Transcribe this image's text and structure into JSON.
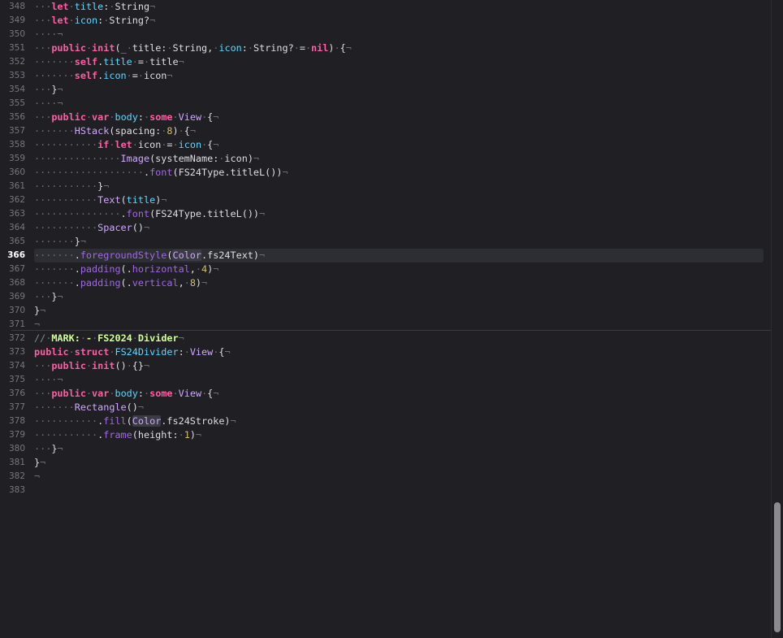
{
  "editor": {
    "current_line": 366,
    "lines": [
      {
        "n": "348",
        "t": [
          [
            "ws",
            "···"
          ],
          [
            "keyword",
            "let"
          ],
          [
            "ws",
            "·"
          ],
          [
            "decl",
            "title"
          ],
          [
            "plain",
            ":"
          ],
          [
            "ws",
            "·"
          ],
          [
            "plain",
            "String"
          ],
          [
            "eol",
            "¬"
          ]
        ]
      },
      {
        "n": "349",
        "t": [
          [
            "ws",
            "···"
          ],
          [
            "keyword",
            "let"
          ],
          [
            "ws",
            "·"
          ],
          [
            "decl",
            "icon"
          ],
          [
            "plain",
            ":"
          ],
          [
            "ws",
            "·"
          ],
          [
            "plain",
            "String?"
          ],
          [
            "eol",
            "¬"
          ]
        ]
      },
      {
        "n": "350",
        "t": [
          [
            "ws",
            "····"
          ],
          [
            "eol",
            "¬"
          ]
        ]
      },
      {
        "n": "351",
        "t": [
          [
            "ws",
            "···"
          ],
          [
            "keyword",
            "public"
          ],
          [
            "ws",
            "·"
          ],
          [
            "keyword",
            "init"
          ],
          [
            "plain",
            "("
          ],
          [
            "decl",
            "_"
          ],
          [
            "ws",
            "·"
          ],
          [
            "plain",
            "title:"
          ],
          [
            "ws",
            "·"
          ],
          [
            "plain",
            "String,"
          ],
          [
            "ws",
            "·"
          ],
          [
            "decl",
            "icon"
          ],
          [
            "plain",
            ":"
          ],
          [
            "ws",
            "·"
          ],
          [
            "plain",
            "String?"
          ],
          [
            "ws",
            "·"
          ],
          [
            "plain",
            "="
          ],
          [
            "ws",
            "·"
          ],
          [
            "keyword",
            "nil"
          ],
          [
            "plain",
            ")"
          ],
          [
            "ws",
            "·"
          ],
          [
            "plain",
            "{"
          ],
          [
            "eol",
            "¬"
          ]
        ]
      },
      {
        "n": "352",
        "t": [
          [
            "ws",
            "·······"
          ],
          [
            "keyword",
            "self"
          ],
          [
            "plain",
            "."
          ],
          [
            "decl",
            "title"
          ],
          [
            "ws",
            "·"
          ],
          [
            "plain",
            "="
          ],
          [
            "ws",
            "·"
          ],
          [
            "plain",
            "title"
          ],
          [
            "eol",
            "¬"
          ]
        ]
      },
      {
        "n": "353",
        "t": [
          [
            "ws",
            "·······"
          ],
          [
            "keyword",
            "self"
          ],
          [
            "plain",
            "."
          ],
          [
            "decl",
            "icon"
          ],
          [
            "ws",
            "·"
          ],
          [
            "plain",
            "="
          ],
          [
            "ws",
            "·"
          ],
          [
            "plain",
            "icon"
          ],
          [
            "eol",
            "¬"
          ]
        ]
      },
      {
        "n": "354",
        "t": [
          [
            "ws",
            "···"
          ],
          [
            "plain",
            "}"
          ],
          [
            "eol",
            "¬"
          ]
        ]
      },
      {
        "n": "355",
        "t": [
          [
            "ws",
            "····"
          ],
          [
            "eol",
            "¬"
          ]
        ]
      },
      {
        "n": "356",
        "t": [
          [
            "ws",
            "···"
          ],
          [
            "keyword",
            "public"
          ],
          [
            "ws",
            "·"
          ],
          [
            "keyword",
            "var"
          ],
          [
            "ws",
            "·"
          ],
          [
            "decl",
            "body"
          ],
          [
            "plain",
            ":"
          ],
          [
            "ws",
            "·"
          ],
          [
            "keyword",
            "some"
          ],
          [
            "ws",
            "·"
          ],
          [
            "type",
            "View"
          ],
          [
            "ws",
            "·"
          ],
          [
            "plain",
            "{"
          ],
          [
            "eol",
            "¬"
          ]
        ]
      },
      {
        "n": "357",
        "t": [
          [
            "ws",
            "·······"
          ],
          [
            "type",
            "HStack"
          ],
          [
            "plain",
            "(spacing:"
          ],
          [
            "ws",
            "·"
          ],
          [
            "number",
            "8"
          ],
          [
            "plain",
            ")"
          ],
          [
            "ws",
            "·"
          ],
          [
            "plain",
            "{"
          ],
          [
            "eol",
            "¬"
          ]
        ]
      },
      {
        "n": "358",
        "t": [
          [
            "ws",
            "···········"
          ],
          [
            "keyword",
            "if"
          ],
          [
            "ws",
            "·"
          ],
          [
            "keyword",
            "let"
          ],
          [
            "ws",
            "·"
          ],
          [
            "plain",
            "icon"
          ],
          [
            "ws",
            "·"
          ],
          [
            "plain",
            "="
          ],
          [
            "ws",
            "·"
          ],
          [
            "decl",
            "icon"
          ],
          [
            "ws",
            "·"
          ],
          [
            "plain",
            "{"
          ],
          [
            "eol",
            "¬"
          ]
        ]
      },
      {
        "n": "359",
        "t": [
          [
            "ws",
            "···············"
          ],
          [
            "type",
            "Image"
          ],
          [
            "plain",
            "(systemName:"
          ],
          [
            "ws",
            "·"
          ],
          [
            "plain",
            "icon)"
          ],
          [
            "eol",
            "¬"
          ]
        ]
      },
      {
        "n": "360",
        "t": [
          [
            "ws",
            "···················"
          ],
          [
            "plain",
            "."
          ],
          [
            "func",
            "font"
          ],
          [
            "plain",
            "(FS24Type.titleL())"
          ],
          [
            "eol",
            "¬"
          ]
        ]
      },
      {
        "n": "361",
        "t": [
          [
            "ws",
            "···········"
          ],
          [
            "plain",
            "}"
          ],
          [
            "eol",
            "¬"
          ]
        ]
      },
      {
        "n": "362",
        "t": [
          [
            "ws",
            "···········"
          ],
          [
            "type",
            "Text"
          ],
          [
            "plain",
            "("
          ],
          [
            "decl",
            "title"
          ],
          [
            "plain",
            ")"
          ],
          [
            "eol",
            "¬"
          ]
        ]
      },
      {
        "n": "363",
        "t": [
          [
            "ws",
            "···············"
          ],
          [
            "plain",
            "."
          ],
          [
            "func",
            "font"
          ],
          [
            "plain",
            "(FS24Type.titleL())"
          ],
          [
            "eol",
            "¬"
          ]
        ]
      },
      {
        "n": "364",
        "t": [
          [
            "ws",
            "···········"
          ],
          [
            "type",
            "Spacer"
          ],
          [
            "plain",
            "()"
          ],
          [
            "eol",
            "¬"
          ]
        ]
      },
      {
        "n": "365",
        "t": [
          [
            "ws",
            "·······"
          ],
          [
            "plain",
            "}"
          ],
          [
            "eol",
            "¬"
          ]
        ]
      },
      {
        "n": "366",
        "t": [
          [
            "ws",
            "·······"
          ],
          [
            "plain",
            "."
          ],
          [
            "func",
            "foregroundStyle"
          ],
          [
            "plain",
            "("
          ],
          [
            "typebg",
            "Color"
          ],
          [
            "plain",
            ".fs24Text)"
          ],
          [
            "eol",
            "¬"
          ]
        ]
      },
      {
        "n": "367",
        "t": [
          [
            "ws",
            "·······"
          ],
          [
            "plain",
            "."
          ],
          [
            "func",
            "padding"
          ],
          [
            "plain",
            "(."
          ],
          [
            "func",
            "horizontal"
          ],
          [
            "plain",
            ","
          ],
          [
            "ws",
            "·"
          ],
          [
            "number",
            "4"
          ],
          [
            "plain",
            ")"
          ],
          [
            "eol",
            "¬"
          ]
        ]
      },
      {
        "n": "368",
        "t": [
          [
            "ws",
            "·······"
          ],
          [
            "plain",
            "."
          ],
          [
            "func",
            "padding"
          ],
          [
            "plain",
            "(."
          ],
          [
            "func",
            "vertical"
          ],
          [
            "plain",
            ","
          ],
          [
            "ws",
            "·"
          ],
          [
            "number",
            "8"
          ],
          [
            "plain",
            ")"
          ],
          [
            "eol",
            "¬"
          ]
        ]
      },
      {
        "n": "369",
        "t": [
          [
            "ws",
            "···"
          ],
          [
            "plain",
            "}"
          ],
          [
            "eol",
            "¬"
          ]
        ]
      },
      {
        "n": "370",
        "t": [
          [
            "plain",
            "}"
          ],
          [
            "eol",
            "¬"
          ]
        ]
      },
      {
        "n": "371",
        "t": [
          [
            "eol",
            "¬"
          ]
        ]
      },
      {
        "n": "372",
        "t": [
          [
            "comment",
            "//"
          ],
          [
            "ws",
            "·"
          ],
          [
            "mark",
            "MARK:"
          ],
          [
            "ws",
            "·"
          ],
          [
            "mark",
            "-"
          ],
          [
            "ws",
            "·"
          ],
          [
            "mark",
            "FS2024"
          ],
          [
            "ws",
            "·"
          ],
          [
            "mark",
            "Divider"
          ],
          [
            "eol",
            "¬"
          ]
        ]
      },
      {
        "n": "373",
        "t": [
          [
            "keyword",
            "public"
          ],
          [
            "ws",
            "·"
          ],
          [
            "keyword",
            "struct"
          ],
          [
            "ws",
            "·"
          ],
          [
            "decl",
            "FS24Divider"
          ],
          [
            "plain",
            ":"
          ],
          [
            "ws",
            "·"
          ],
          [
            "type",
            "View"
          ],
          [
            "ws",
            "·"
          ],
          [
            "plain",
            "{"
          ],
          [
            "eol",
            "¬"
          ]
        ]
      },
      {
        "n": "374",
        "t": [
          [
            "ws",
            "···"
          ],
          [
            "keyword",
            "public"
          ],
          [
            "ws",
            "·"
          ],
          [
            "keyword",
            "init"
          ],
          [
            "plain",
            "()"
          ],
          [
            "ws",
            "·"
          ],
          [
            "plain",
            "{}"
          ],
          [
            "eol",
            "¬"
          ]
        ]
      },
      {
        "n": "375",
        "t": [
          [
            "ws",
            "····"
          ],
          [
            "eol",
            "¬"
          ]
        ]
      },
      {
        "n": "376",
        "t": [
          [
            "ws",
            "···"
          ],
          [
            "keyword",
            "public"
          ],
          [
            "ws",
            "·"
          ],
          [
            "keyword",
            "var"
          ],
          [
            "ws",
            "·"
          ],
          [
            "decl",
            "body"
          ],
          [
            "plain",
            ":"
          ],
          [
            "ws",
            "·"
          ],
          [
            "keyword",
            "some"
          ],
          [
            "ws",
            "·"
          ],
          [
            "type",
            "View"
          ],
          [
            "ws",
            "·"
          ],
          [
            "plain",
            "{"
          ],
          [
            "eol",
            "¬"
          ]
        ]
      },
      {
        "n": "377",
        "t": [
          [
            "ws",
            "·······"
          ],
          [
            "type",
            "Rectangle"
          ],
          [
            "plain",
            "()"
          ],
          [
            "eol",
            "¬"
          ]
        ]
      },
      {
        "n": "378",
        "t": [
          [
            "ws",
            "···········"
          ],
          [
            "plain",
            "."
          ],
          [
            "func",
            "fill"
          ],
          [
            "plain",
            "("
          ],
          [
            "typebg",
            "Color"
          ],
          [
            "plain",
            ".fs24Stroke)"
          ],
          [
            "eol",
            "¬"
          ]
        ]
      },
      {
        "n": "379",
        "t": [
          [
            "ws",
            "···········"
          ],
          [
            "plain",
            "."
          ],
          [
            "func",
            "frame"
          ],
          [
            "plain",
            "(height:"
          ],
          [
            "ws",
            "·"
          ],
          [
            "number",
            "1"
          ],
          [
            "plain",
            ")"
          ],
          [
            "eol",
            "¬"
          ]
        ]
      },
      {
        "n": "380",
        "t": [
          [
            "ws",
            "···"
          ],
          [
            "plain",
            "}"
          ],
          [
            "eol",
            "¬"
          ]
        ]
      },
      {
        "n": "381",
        "t": [
          [
            "plain",
            "}"
          ],
          [
            "eol",
            "¬"
          ]
        ]
      },
      {
        "n": "382",
        "t": [
          [
            "eol",
            "¬"
          ]
        ]
      },
      {
        "n": "383",
        "t": []
      }
    ]
  },
  "colors": {
    "background": "#1f1f24",
    "current_line": "#2d2e34",
    "keyword": "#fc5fa3",
    "declaration": "#5dd8ff",
    "type": "#d0a8ff",
    "function": "#a167e6",
    "number": "#d0bf69",
    "comment": "#7f8c98",
    "mark": "#d2ff98"
  }
}
